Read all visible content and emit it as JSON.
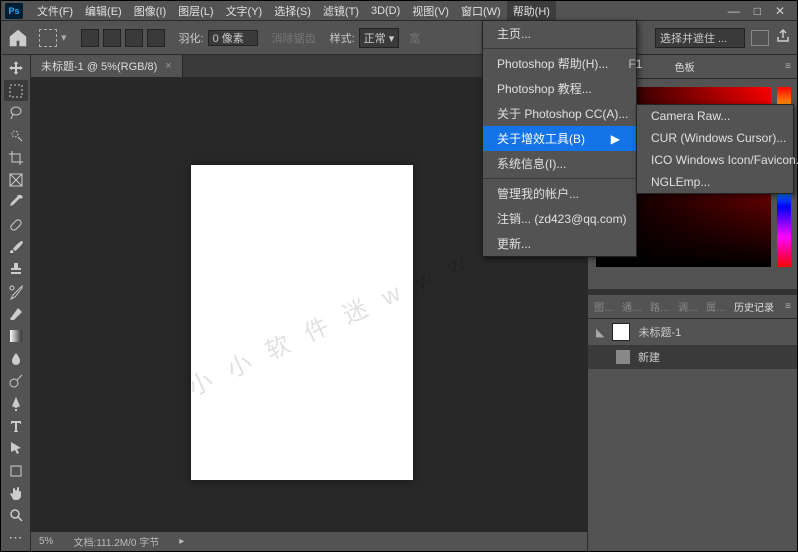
{
  "menubar": {
    "items": [
      "文件(F)",
      "编辑(E)",
      "图像(I)",
      "图层(L)",
      "文字(Y)",
      "选择(S)",
      "滤镜(T)",
      "3D(D)",
      "视图(V)",
      "窗口(W)",
      "帮助(H)"
    ]
  },
  "optionsbar": {
    "feather_label": "羽化:",
    "feather_value": "0 像素",
    "antialias": "消除锯齿",
    "style_label": "样式:",
    "style_value": "正常",
    "width_label": "宽",
    "select_mask": "选择并遮住 ..."
  },
  "document": {
    "tab_title": "未标题-1 @ 5%(RGB/8)",
    "zoom": "5%",
    "status": "文档:111.2M/0 字节"
  },
  "help_menu": {
    "items": [
      {
        "label": "主页...",
        "sep_after": true
      },
      {
        "label": "Photoshop 帮助(H)...",
        "shortcut": "F1"
      },
      {
        "label": "Photoshop 教程..."
      },
      {
        "label": "关于 Photoshop CC(A)..."
      },
      {
        "label": "关于增效工具(B)",
        "submenu": true,
        "highlight": true
      },
      {
        "label": "系统信息(I)...",
        "sep_after": true
      },
      {
        "label": "管理我的帐户..."
      },
      {
        "label": "注销... (zd423@qq.com)"
      },
      {
        "label": "更新..."
      }
    ]
  },
  "plugins_menu": {
    "items": [
      {
        "label": "Camera Raw..."
      },
      {
        "label": "CUR (Windows Cursor)..."
      },
      {
        "label": "ICO Windows Icon/Favicon..."
      },
      {
        "label": "NGLEmp..."
      }
    ]
  },
  "panels": {
    "color_tab": "色板",
    "history_tabs": [
      "图…",
      "通…",
      "路…",
      "调…",
      "属…",
      "历史记录"
    ],
    "history_active": "历史记录",
    "history_doc": "未标题-1",
    "history_step": "新建"
  },
  "watermark": "小 小 软 件 迷  w w w . x x r j m . c o m"
}
